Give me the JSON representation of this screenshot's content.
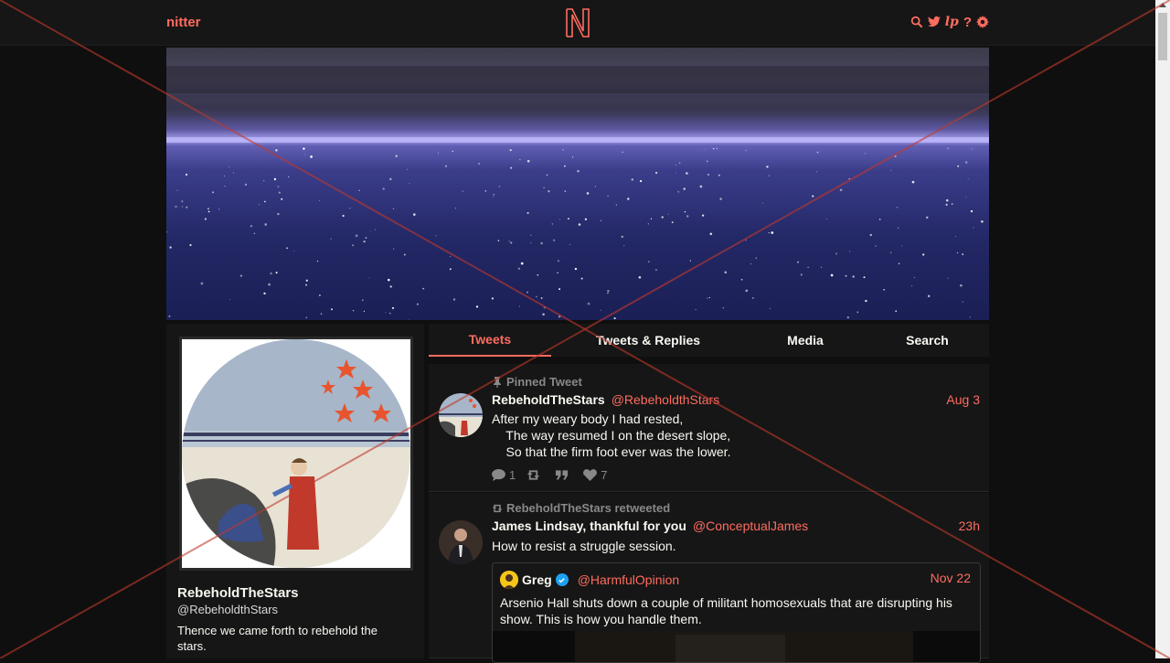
{
  "nav": {
    "brand": "nitter",
    "icons": [
      "search-icon",
      "twitter-bird-icon",
      "lp-icon",
      "help-icon",
      "gear-icon"
    ],
    "lp_text": "lp",
    "help_text": "?"
  },
  "colors": {
    "accent": "#ff6c60",
    "background": "#0f0f0f",
    "panel": "#161616",
    "text": "#f8f8f2",
    "muted": "#888888"
  },
  "profile": {
    "fullname": "RebeholdTheStars",
    "username": "@RebeholdthStars",
    "bio": "Thence we came forth to rebehold the stars."
  },
  "tabs": [
    {
      "label": "Tweets",
      "active": true
    },
    {
      "label": "Tweets & Replies",
      "active": false
    },
    {
      "label": "Media",
      "active": false
    },
    {
      "label": "Search",
      "active": false
    }
  ],
  "tweets": [
    {
      "meta": "Pinned Tweet",
      "fullname": "RebeholdTheStars",
      "username": "@RebeholdthStars",
      "date": "Aug 3",
      "body": "After my weary body I had rested,\n    The way resumed I on the desert slope,\n    So that the firm foot ever was the lower.",
      "replies": "1",
      "retweets": "",
      "quotes": "",
      "likes": "7"
    },
    {
      "meta": "RebeholdTheStars retweeted",
      "fullname": "James Lindsay, thankful for you",
      "username": "@ConceptualJames",
      "date": "23h",
      "body": "How to resist a struggle session.",
      "quote": {
        "fullname": "Greg",
        "username": "@HarmfulOpinion",
        "date": "Nov 22",
        "text": "Arsenio Hall shuts down a couple of militant homosexuals that are disrupting his show. This is how you handle them."
      }
    }
  ]
}
